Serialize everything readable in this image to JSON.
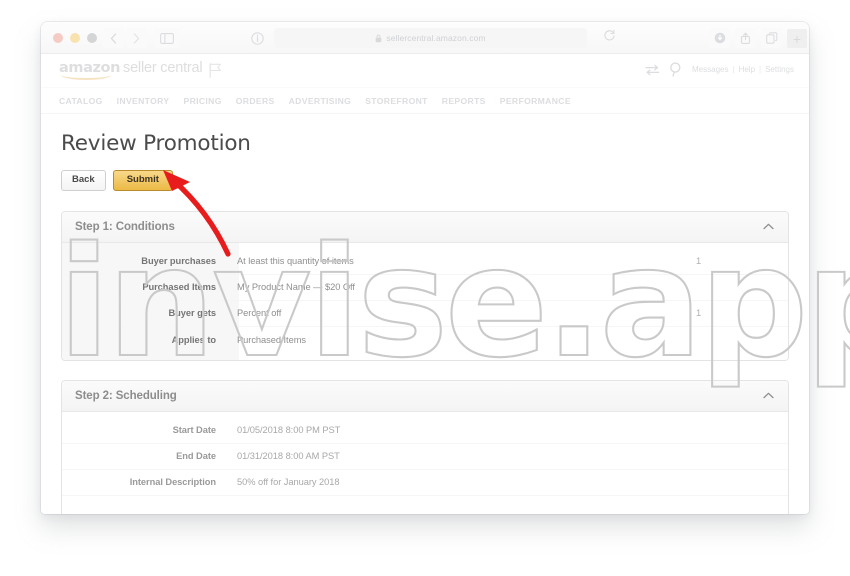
{
  "browser": {
    "url": "sellercentral.amazon.com",
    "lock_icon": "lock-icon",
    "back_icon": "chevron-left-icon",
    "forward_icon": "chevron-right-icon",
    "sidebar_icon": "sidebar-toggle-icon",
    "reader_icon": "page-info-icon",
    "reload_icon": "reload-icon",
    "download_icon": "download-icon",
    "share_icon": "share-icon",
    "tabs_icon": "show-tabs-icon",
    "newtab_label": "+",
    "traffic_lights": [
      "close-button",
      "minimize-button",
      "zoom-button"
    ]
  },
  "site_header": {
    "brand_primary": "amazon",
    "brand_secondary": "seller central",
    "flag_icon": "flag-icon",
    "switch_accounts_icon": "switch-accounts-icon",
    "search_icon": "search-icon",
    "links": [
      "Messages",
      "Help",
      "Settings"
    ],
    "separator": "|"
  },
  "main_nav": {
    "items": [
      "CATALOG",
      "INVENTORY",
      "PRICING",
      "ORDERS",
      "ADVERTISING",
      "STOREFRONT",
      "REPORTS",
      "PERFORMANCE"
    ]
  },
  "content": {
    "page_title": "Review Promotion",
    "buttons": {
      "back_label": "Back",
      "submit_label": "Submit"
    },
    "panels": [
      {
        "title": "Step 1: Conditions",
        "collapse_icon": "chevron-up-icon",
        "rows": [
          {
            "label": "Buyer purchases",
            "value": "At least this quantity of items",
            "qty": "1"
          },
          {
            "label": "Purchased Items",
            "value": "My Product Name — $20 Off",
            "qty": ""
          },
          {
            "label": "Buyer gets",
            "value": "Percent off",
            "qty": "1"
          },
          {
            "label": "Applies to",
            "value": "Purchased Items",
            "qty": ""
          }
        ]
      },
      {
        "title": "Step 2: Scheduling",
        "collapse_icon": "chevron-up-icon",
        "rows": [
          {
            "label": "Start Date",
            "value": "01/05/2018  8:00 PM  PST",
            "qty": ""
          },
          {
            "label": "End Date",
            "value": "01/31/2018  8:00 AM  PST",
            "qty": ""
          },
          {
            "label": "Internal Description",
            "value": "50% off for January 2018",
            "qty": ""
          },
          {
            "label": "",
            "value": "",
            "qty": ""
          }
        ]
      }
    ]
  },
  "annotation": {
    "arrow_icon": "red-arrow-pointer",
    "arrow_color": "#e81c1c",
    "points_at": "submit-button"
  },
  "watermark": {
    "text": "invise.app",
    "color": "#c9c9c9"
  }
}
